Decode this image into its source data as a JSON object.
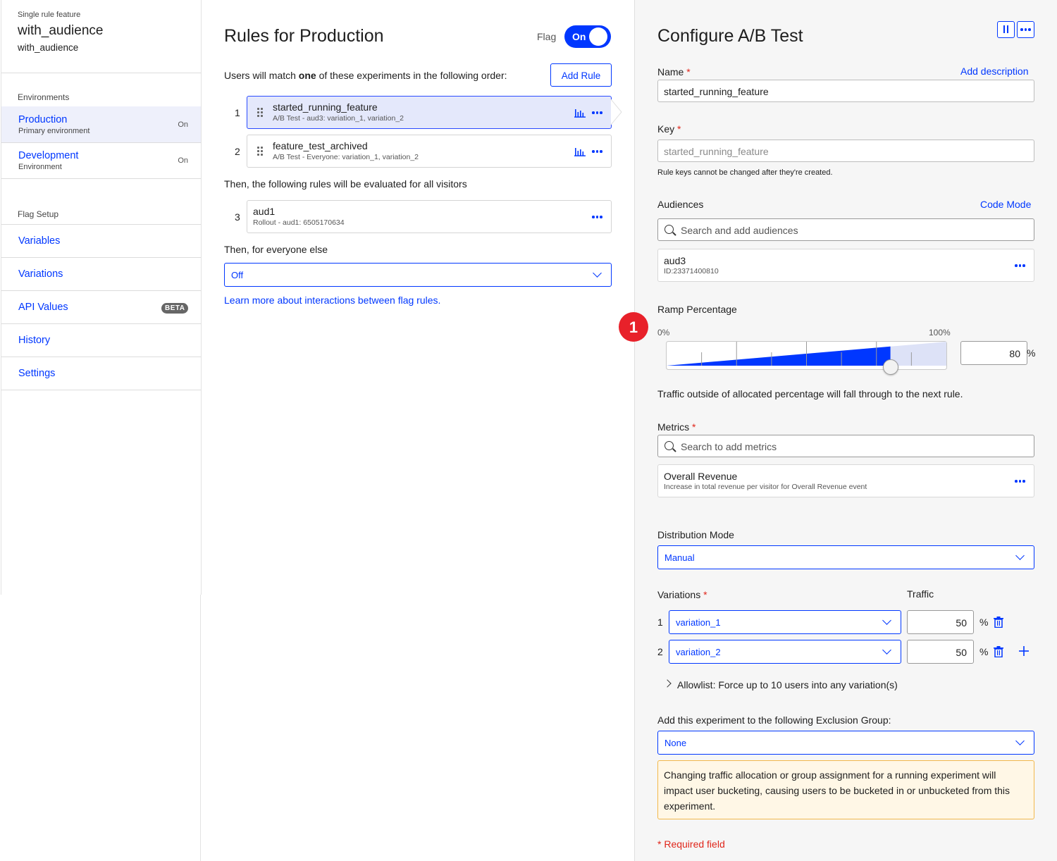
{
  "sidebar": {
    "feature_type": "Single rule feature",
    "feature_name": "with_audience",
    "feature_key": "with_audience",
    "environments_heading": "Environments",
    "environments": [
      {
        "name": "Production",
        "sub": "Primary environment",
        "status": "On",
        "selected": true
      },
      {
        "name": "Development",
        "sub": "Environment",
        "status": "On",
        "selected": false
      }
    ],
    "flag_setup_heading": "Flag Setup",
    "nav": [
      {
        "label": "Variables"
      },
      {
        "label": "Variations"
      },
      {
        "label": "API Values",
        "badge": "BETA"
      },
      {
        "label": "History"
      },
      {
        "label": "Settings"
      }
    ]
  },
  "middle": {
    "title": "Rules for Production",
    "flag_label": "Flag",
    "flag_toggle": "On",
    "intro_pre": "Users will match ",
    "intro_bold": "one",
    "intro_post": " of these experiments in the following order:",
    "add_rule": "Add Rule",
    "rules": [
      {
        "num": "1",
        "title": "started_running_feature",
        "sub": "A/B Test - aud3: variation_1, variation_2"
      },
      {
        "num": "2",
        "title": "feature_test_archived",
        "sub": "A/B Test - Everyone: variation_1, variation_2"
      }
    ],
    "then_all": "Then, the following rules will be evaluated for all visitors",
    "rollout": {
      "num": "3",
      "title": "aud1",
      "sub": "Rollout - aud1: 6505170634"
    },
    "then_else": "Then, for everyone else",
    "else_value": "Off",
    "learn_more": "Learn more about interactions between flag rules."
  },
  "right": {
    "title": "Configure A/B Test",
    "name_label": "Name",
    "required_mark": "*",
    "add_description": "Add description",
    "name_value": "started_running_feature",
    "key_label": "Key",
    "key_placeholder": "started_running_feature",
    "key_note": "Rule keys cannot be changed after they're created.",
    "audiences_label": "Audiences",
    "code_mode": "Code Mode",
    "audience_search_placeholder": "Search and add audiences",
    "audience": {
      "name": "aud3",
      "id": "ID:23371400810"
    },
    "annotation_marker": "1",
    "ramp_label": "Ramp Percentage",
    "ramp_min": "0%",
    "ramp_max": "100%",
    "ramp_value": 80,
    "ramp_value_text": "80",
    "percent_sign": "%",
    "ramp_note": "Traffic outside of allocated percentage will fall through to the next rule.",
    "metrics_label": "Metrics",
    "metrics_search_placeholder": "Search to add metrics",
    "metric": {
      "name": "Overall Revenue",
      "desc": "Increase in total revenue per visitor for Overall Revenue event"
    },
    "distribution_label": "Distribution Mode",
    "distribution_value": "Manual",
    "variations_label": "Variations",
    "traffic_label": "Traffic",
    "variations": [
      {
        "num": "1",
        "name": "variation_1",
        "traffic": "50"
      },
      {
        "num": "2",
        "name": "variation_2",
        "traffic": "50"
      }
    ],
    "allowlist": "Allowlist: Force up to 10 users into any variation(s)",
    "exclusion_label": "Add this experiment to the following Exclusion Group:",
    "exclusion_value": "None",
    "warning": "Changing traffic allocation or group assignment for a running experiment will impact user bucketing, causing users to be bucketed in or unbucketed from this experiment.",
    "required_note": "* Required field"
  },
  "colors": {
    "accent": "#0037ff",
    "required": "#e0261b",
    "warning_bg": "#fff7e6",
    "warning_border": "#f2b84b",
    "marker": "#e8212a"
  }
}
